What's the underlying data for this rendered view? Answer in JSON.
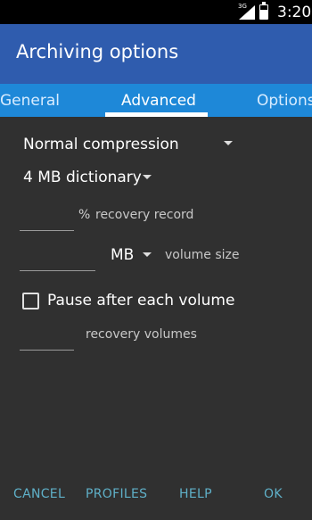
{
  "status": {
    "network": "3G",
    "time": "3:20"
  },
  "dialog": {
    "title": "Archiving options"
  },
  "tabs": [
    {
      "label": "General",
      "active": false
    },
    {
      "label": "Advanced",
      "active": true
    },
    {
      "label": "Options",
      "active": false
    }
  ],
  "advanced": {
    "compression": "Normal compression",
    "dictionary": "4 MB dictionary",
    "recovery_record": {
      "value": "",
      "unit": "%",
      "label": "recovery record"
    },
    "volume_size": {
      "value": "",
      "unit": "MB",
      "label": "volume size"
    },
    "pause_checkbox": {
      "label": "Pause after each volume",
      "checked": false
    },
    "recovery_volumes": {
      "value": "",
      "label": "recovery volumes"
    }
  },
  "actions": {
    "cancel": "CANCEL",
    "profiles": "PROFILES",
    "help": "HELP",
    "ok": "OK"
  },
  "colors": {
    "header": "#2f5cae",
    "tabs": "#1e88d8",
    "panel": "#303030",
    "action_text": "#5fb0c8"
  }
}
